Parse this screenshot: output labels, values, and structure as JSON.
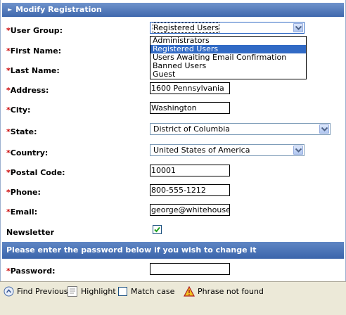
{
  "form": {
    "title": "Modify Registration",
    "required_mark": "*",
    "user_group": {
      "label": "User Group:",
      "value": "Registered Users",
      "options": [
        "Administrators",
        "Registered Users",
        "Users Awaiting Email Confirmation",
        "Banned Users",
        "Guest"
      ],
      "selected_option": "Registered Users"
    },
    "first_name": {
      "label": "First Name:"
    },
    "last_name": {
      "label": "Last Name:"
    },
    "address": {
      "label": "Address:",
      "value": "1600 Pennsylvania"
    },
    "city": {
      "label": "City:",
      "value": "Washington"
    },
    "state": {
      "label": "State:",
      "value": "District of Columbia"
    },
    "country": {
      "label": "Country:",
      "value": "United States of America"
    },
    "postal_code": {
      "label": "Postal Code:",
      "value": "10001"
    },
    "phone": {
      "label": "Phone:",
      "value": "800-555-1212"
    },
    "email": {
      "label": "Email:",
      "value": "george@whitehouse"
    },
    "newsletter": {
      "label": "Newsletter",
      "checked": true
    },
    "password_section": "Please enter the password below if you wish to change it",
    "password": {
      "label": "Password:",
      "value": ""
    }
  },
  "find_bar": {
    "find_previous": "Find Previous",
    "highlight": "Highlight",
    "match_case": "Match case",
    "status": "Phrase not found"
  },
  "colors": {
    "header": "#4a72b5",
    "required": "#cc0000",
    "selection": "#316ac5",
    "toolbar": "#ece9d8"
  }
}
